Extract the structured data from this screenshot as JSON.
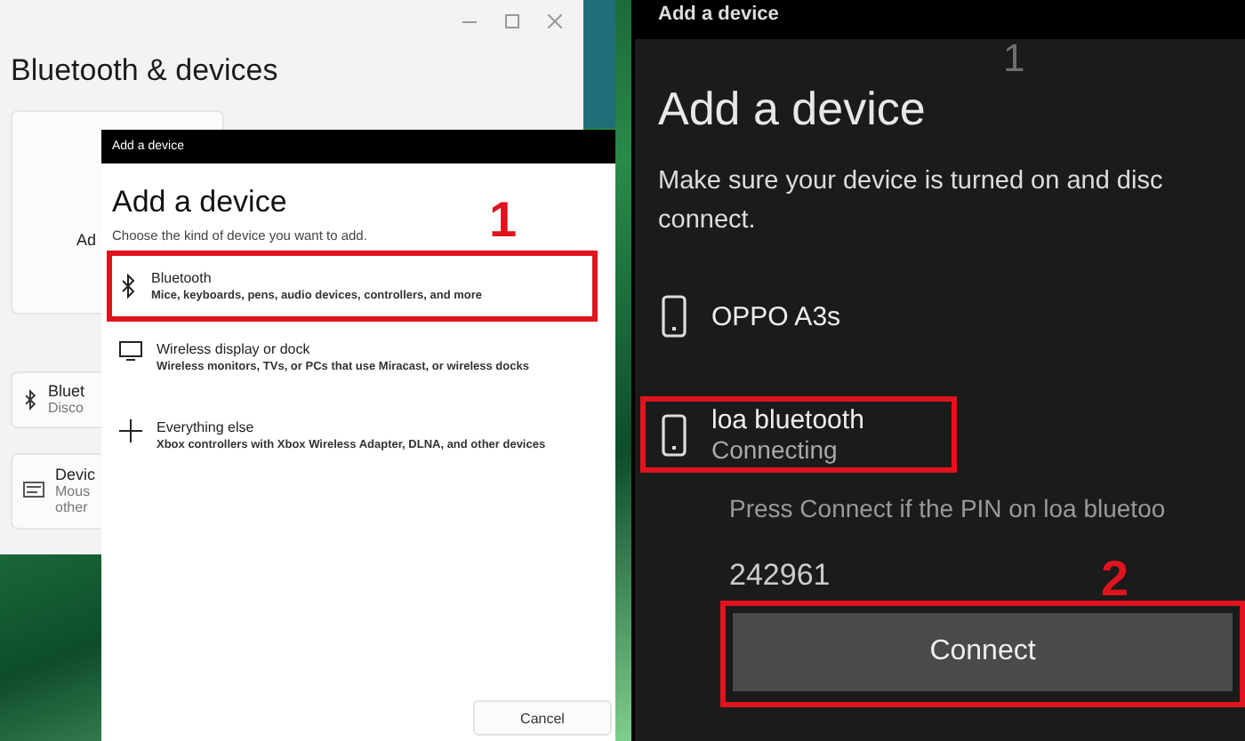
{
  "settings_window": {
    "title": "Bluetooth & devices",
    "cards": [
      {
        "kind": "add",
        "title": "Ad"
      },
      {
        "kind": "bluetooth",
        "title": "Bluet",
        "subtitle": "Disco"
      },
      {
        "kind": "devices",
        "title": "Devic",
        "subtitle": "Mous",
        "subtitle_2": "other"
      }
    ]
  },
  "light_dialog": {
    "titlebar": "Add a device",
    "heading": "Add a device",
    "prompt": "Choose the kind of device you want to add.",
    "step_label": "1",
    "options": [
      {
        "kind": "bluetooth",
        "title": "Bluetooth",
        "description": "Mice, keyboards, pens, audio devices, controllers, and more",
        "highlighted": true
      },
      {
        "kind": "display",
        "title": "Wireless display or dock",
        "description": "Wireless monitors, TVs, or PCs that use Miracast, or wireless docks",
        "highlighted": false
      },
      {
        "kind": "other",
        "title": "Everything else",
        "description": "Xbox controllers with Xbox Wireless Adapter, DLNA, and other devices",
        "highlighted": false
      }
    ],
    "cancel_button": "Cancel"
  },
  "dark_dialog": {
    "titlebar": "Add a device",
    "top_label": "1",
    "heading": "Add a device",
    "prompt_lines": [
      "Make sure your device is turned on and disc",
      "connect."
    ],
    "devices": [
      {
        "name": "OPPO A3s",
        "highlighted": false
      },
      {
        "name": "loa bluetooth",
        "status": "Connecting",
        "highlighted": true
      }
    ],
    "pin_prompt": "Press Connect if the PIN on loa bluetoo",
    "pin": "242961",
    "step_label": "2",
    "connect_button": "Connect",
    "connect_highlighted": true
  }
}
